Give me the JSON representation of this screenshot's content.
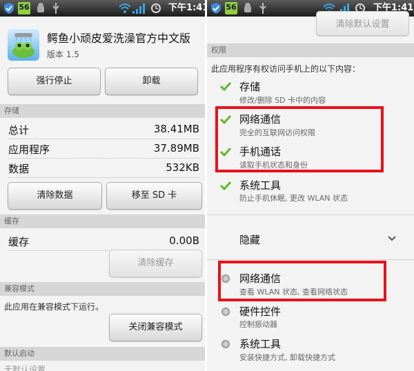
{
  "status_bar": {
    "badge": "56",
    "time": "下午1:41"
  },
  "app": {
    "name": "鳄鱼小顽皮爱洗澡官方中文版",
    "version": "版本 1.5"
  },
  "buttons": {
    "force_stop": "强行停止",
    "uninstall": "卸载",
    "clear_data": "清除数据",
    "move_to_sd": "移至 SD 卡",
    "clear_cache": "清除缓存",
    "close_compat": "关闭兼容模式",
    "clear_defaults": "清除默认设置"
  },
  "storage": {
    "header": "存储",
    "rows": [
      {
        "label": "总计",
        "value": "38.41MB"
      },
      {
        "label": "应用程序",
        "value": "37.89MB"
      },
      {
        "label": "数据",
        "value": "532KB"
      }
    ]
  },
  "cache": {
    "header": "缓存",
    "label": "缓存",
    "value": "0.00B"
  },
  "compat": {
    "header": "兼容模式",
    "text": "此应用在兼容模式下运行。"
  },
  "defaults": {
    "header": "默认启动",
    "partial_text": "无默认设置"
  },
  "permissions": {
    "header": "权限",
    "intro": "此应用程序有权访问手机上的以下内容：",
    "visible": [
      {
        "title": "存储",
        "desc": "修改/删除 SD 卡中的内容"
      },
      {
        "title": "网络通信",
        "desc": "完全的互联网访问权限"
      },
      {
        "title": "手机通话",
        "desc": "读取手机状态和身份"
      },
      {
        "title": "系统工具",
        "desc": "防止手机休眠, 更改 WLAN 状态"
      }
    ],
    "hidden_label": "隐藏",
    "hidden": [
      {
        "title": "网络通信",
        "desc": "查看 WLAN 状态, 查看网络状态"
      },
      {
        "title": "硬件控件",
        "desc": "控制振动器"
      },
      {
        "title": "系统工具",
        "desc": "安装快捷方式, 卸载快捷方式"
      }
    ]
  },
  "colors": {
    "check": "#5db82a",
    "highlight": "#e8101a",
    "section_bg": "#d6d6d6"
  }
}
